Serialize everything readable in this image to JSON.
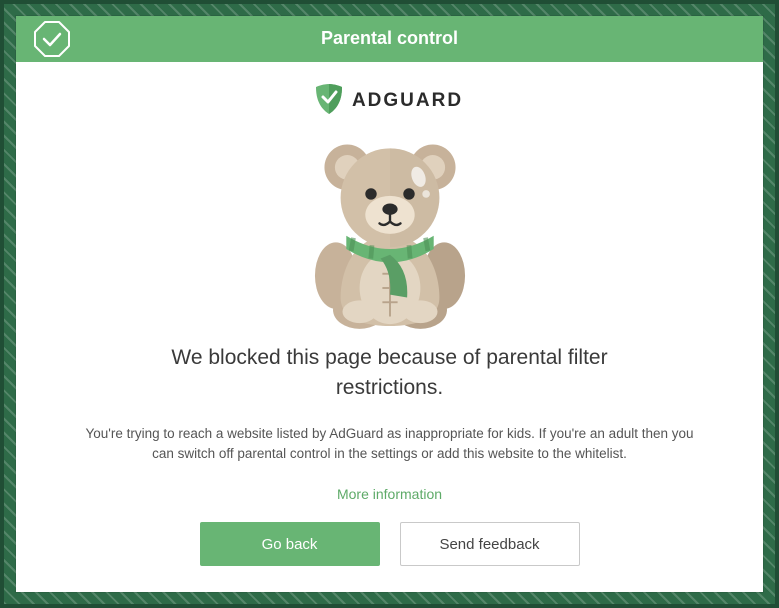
{
  "header": {
    "title": "Parental control"
  },
  "brand": {
    "name": "ADGUARD"
  },
  "headline": "We blocked this page because of parental filter restrictions.",
  "subtext": "You're trying to reach a website listed by AdGuard as inappropriate for kids. If you're an adult then you can switch off parental control in the settings or add this website to the whitelist.",
  "links": {
    "more_info": "More information"
  },
  "buttons": {
    "go_back": "Go back",
    "send_feedback": "Send feedback"
  },
  "colors": {
    "accent": "#68b574"
  }
}
